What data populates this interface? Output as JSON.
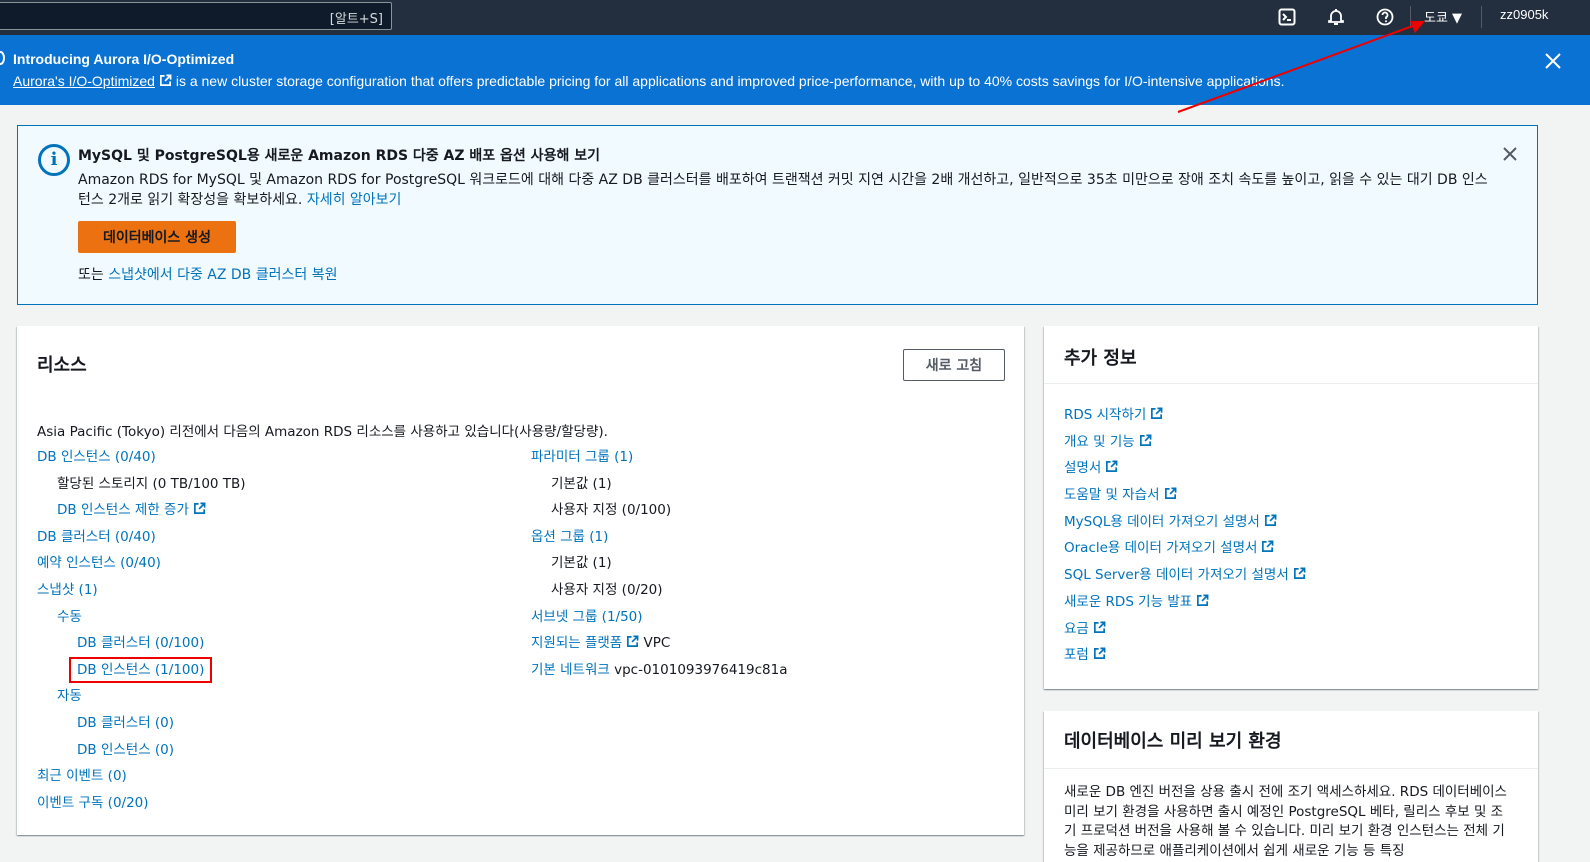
{
  "topnav": {
    "search_shortcut": "[알트+S]",
    "region": "도쿄 ▼",
    "user": "zz0905k"
  },
  "banner": {
    "title": "Introducing Aurora I/O-Optimized",
    "link": "Aurora's I/O-Optimized",
    "text": " is a new cluster storage configuration that offers predictable pricing for all applications and improved price-performance, with up to 40% costs savings for I/O-intensive applications."
  },
  "alert": {
    "title": "MySQL 및 PostgreSQL용 새로운 Amazon RDS 다중 AZ 배포 옵션 사용해 보기",
    "body": "Amazon RDS for MySQL 및 Amazon RDS for PostgreSQL 워크로드에 대해 다중 AZ DB 클러스터를 배포하여 트랜잭션 커밋 지연 시간을 2배 개선하고, 일반적으로 35초 미만으로 장애 조치 속도를 높이고, 읽을 수 있는 대기 DB 인스턴스 2개로 읽기 확장성을 확보하세요.",
    "learn_more": "자세히 알아보기",
    "create_button": "데이터베이스 생성",
    "or_text": "또는 ",
    "restore_link": "스냅샷에서 다중 AZ DB 클러스터 복원"
  },
  "resources": {
    "title": "리소스",
    "refresh": "새로 고침",
    "description": "Asia Pacific (Tokyo) 리전에서 다음의 Amazon RDS 리소스를 사용하고 있습니다(사용량/할당량).",
    "left": [
      {
        "label": "DB 인스턴스 (0/40)",
        "type": "link",
        "indent": 0
      },
      {
        "label": "할당된 스토리지 (0 TB/100 TB)",
        "type": "text",
        "indent": 1
      },
      {
        "label": "DB 인스턴스 제한 증가",
        "type": "ext",
        "indent": 1
      },
      {
        "label": "DB 클러스터 (0/40)",
        "type": "link",
        "indent": 0
      },
      {
        "label": "예약 인스턴스 (0/40)",
        "type": "link",
        "indent": 0
      },
      {
        "label": "스냅샷 (1)",
        "type": "link",
        "indent": 0
      },
      {
        "label": "수동",
        "type": "link",
        "indent": 1
      },
      {
        "label": "DB 클러스터 (0/100)",
        "type": "link",
        "indent": 2
      },
      {
        "label": "DB 인스턴스 (1/100)",
        "type": "highlight",
        "indent": 2
      },
      {
        "label": "자동",
        "type": "link",
        "indent": 1
      },
      {
        "label": "DB 클러스터 (0)",
        "type": "link",
        "indent": 2
      },
      {
        "label": "DB 인스턴스 (0)",
        "type": "link",
        "indent": 2
      },
      {
        "label": "최근 이벤트 (0)",
        "type": "link",
        "indent": 0
      },
      {
        "label": "이벤트 구독 (0/20)",
        "type": "link",
        "indent": 0
      }
    ],
    "right": [
      {
        "label": "파라미터 그룹 (1)",
        "type": "link",
        "indent": 0
      },
      {
        "label": "기본값 (1)",
        "type": "text",
        "indent": 1
      },
      {
        "label": "사용자 지정 (0/100)",
        "type": "text",
        "indent": 1
      },
      {
        "label": "옵션 그룹 (1)",
        "type": "link",
        "indent": 0
      },
      {
        "label": "기본값 (1)",
        "type": "text",
        "indent": 1
      },
      {
        "label": "사용자 지정 (0/20)",
        "type": "text",
        "indent": 1
      },
      {
        "label": "서브넷 그룹 (1/50)",
        "type": "link",
        "indent": 0
      },
      {
        "label": "지원되는 플랫폼",
        "type": "ext",
        "indent": 0,
        "suffix": " VPC"
      },
      {
        "label": "기본 네트워크",
        "type": "link",
        "indent": 0,
        "suffix": " vpc-0101093976419c81a"
      }
    ]
  },
  "info": {
    "title": "추가 정보",
    "links": [
      "RDS 시작하기",
      "개요 및 기능",
      "설명서",
      "도움말 및 자습서",
      "MySQL용 데이터 가져오기 설명서",
      "Oracle용 데이터 가져오기 설명서",
      "SQL Server용 데이터 가져오기 설명서",
      "새로운 RDS 기능 발표",
      "요금",
      "포럼"
    ]
  },
  "preview": {
    "title": "데이터베이스 미리 보기 환경",
    "body": "새로운 DB 엔진 버전을 상용 출시 전에 조기 액세스하세요. RDS 데이터베이스 미리 보기 환경을 사용하면 출시 예정인 PostgreSQL 베타, 릴리스 후보 및 조기 프로덕션 버전을 사용해 볼 수 있습니다. 미리 보기 환경 인스턴스는 전체 기능을 제공하므로 애플리케이션에서 쉽게 새로운 기능 등 특징"
  },
  "colors": {
    "link": "#0073bb",
    "banner": "#0972d3",
    "primary_button": "#ec7211",
    "highlight": "#e00000"
  }
}
